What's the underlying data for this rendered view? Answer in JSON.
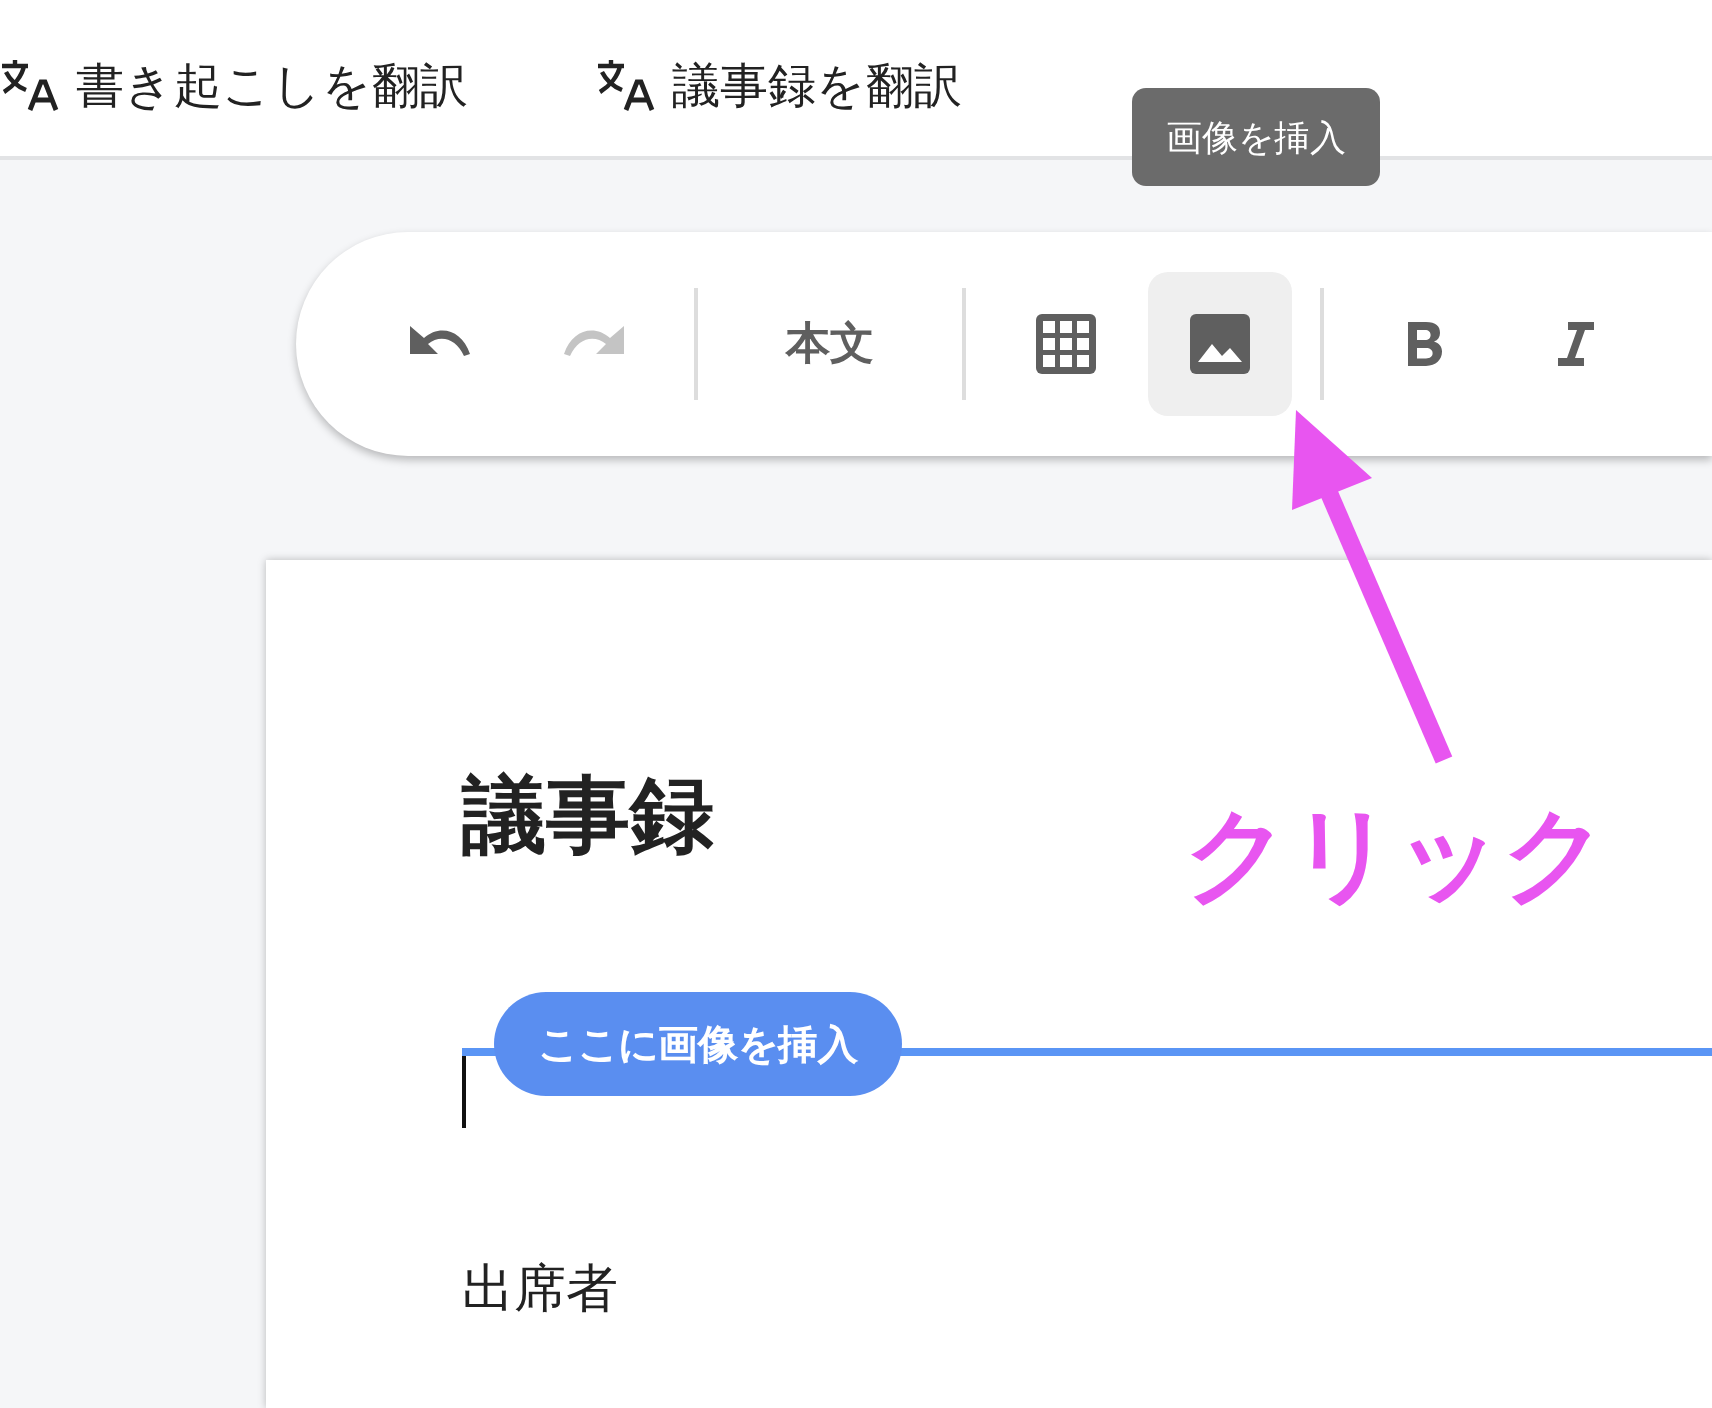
{
  "header": {
    "actions": [
      {
        "label": "書き起こしを翻訳"
      },
      {
        "label": "議事録を翻訳"
      }
    ]
  },
  "tooltip": {
    "text": "画像を挿入"
  },
  "toolbar": {
    "groups": [
      [
        {
          "kind": "undo",
          "disabled": false,
          "selected": false
        },
        {
          "kind": "redo",
          "disabled": true,
          "selected": false
        }
      ],
      [
        {
          "kind": "text-style",
          "label": "本文",
          "disabled": false,
          "selected": false
        }
      ],
      [
        {
          "kind": "table",
          "disabled": false,
          "selected": false
        },
        {
          "kind": "image",
          "disabled": false,
          "selected": true
        }
      ],
      [
        {
          "kind": "bold",
          "disabled": false,
          "selected": false
        },
        {
          "kind": "italic",
          "disabled": false,
          "selected": false
        }
      ]
    ]
  },
  "document": {
    "title": "議事録",
    "insert_marker": "ここに画像を挿入",
    "paragraph": "出席者"
  },
  "annotation": {
    "label": "クリック"
  }
}
